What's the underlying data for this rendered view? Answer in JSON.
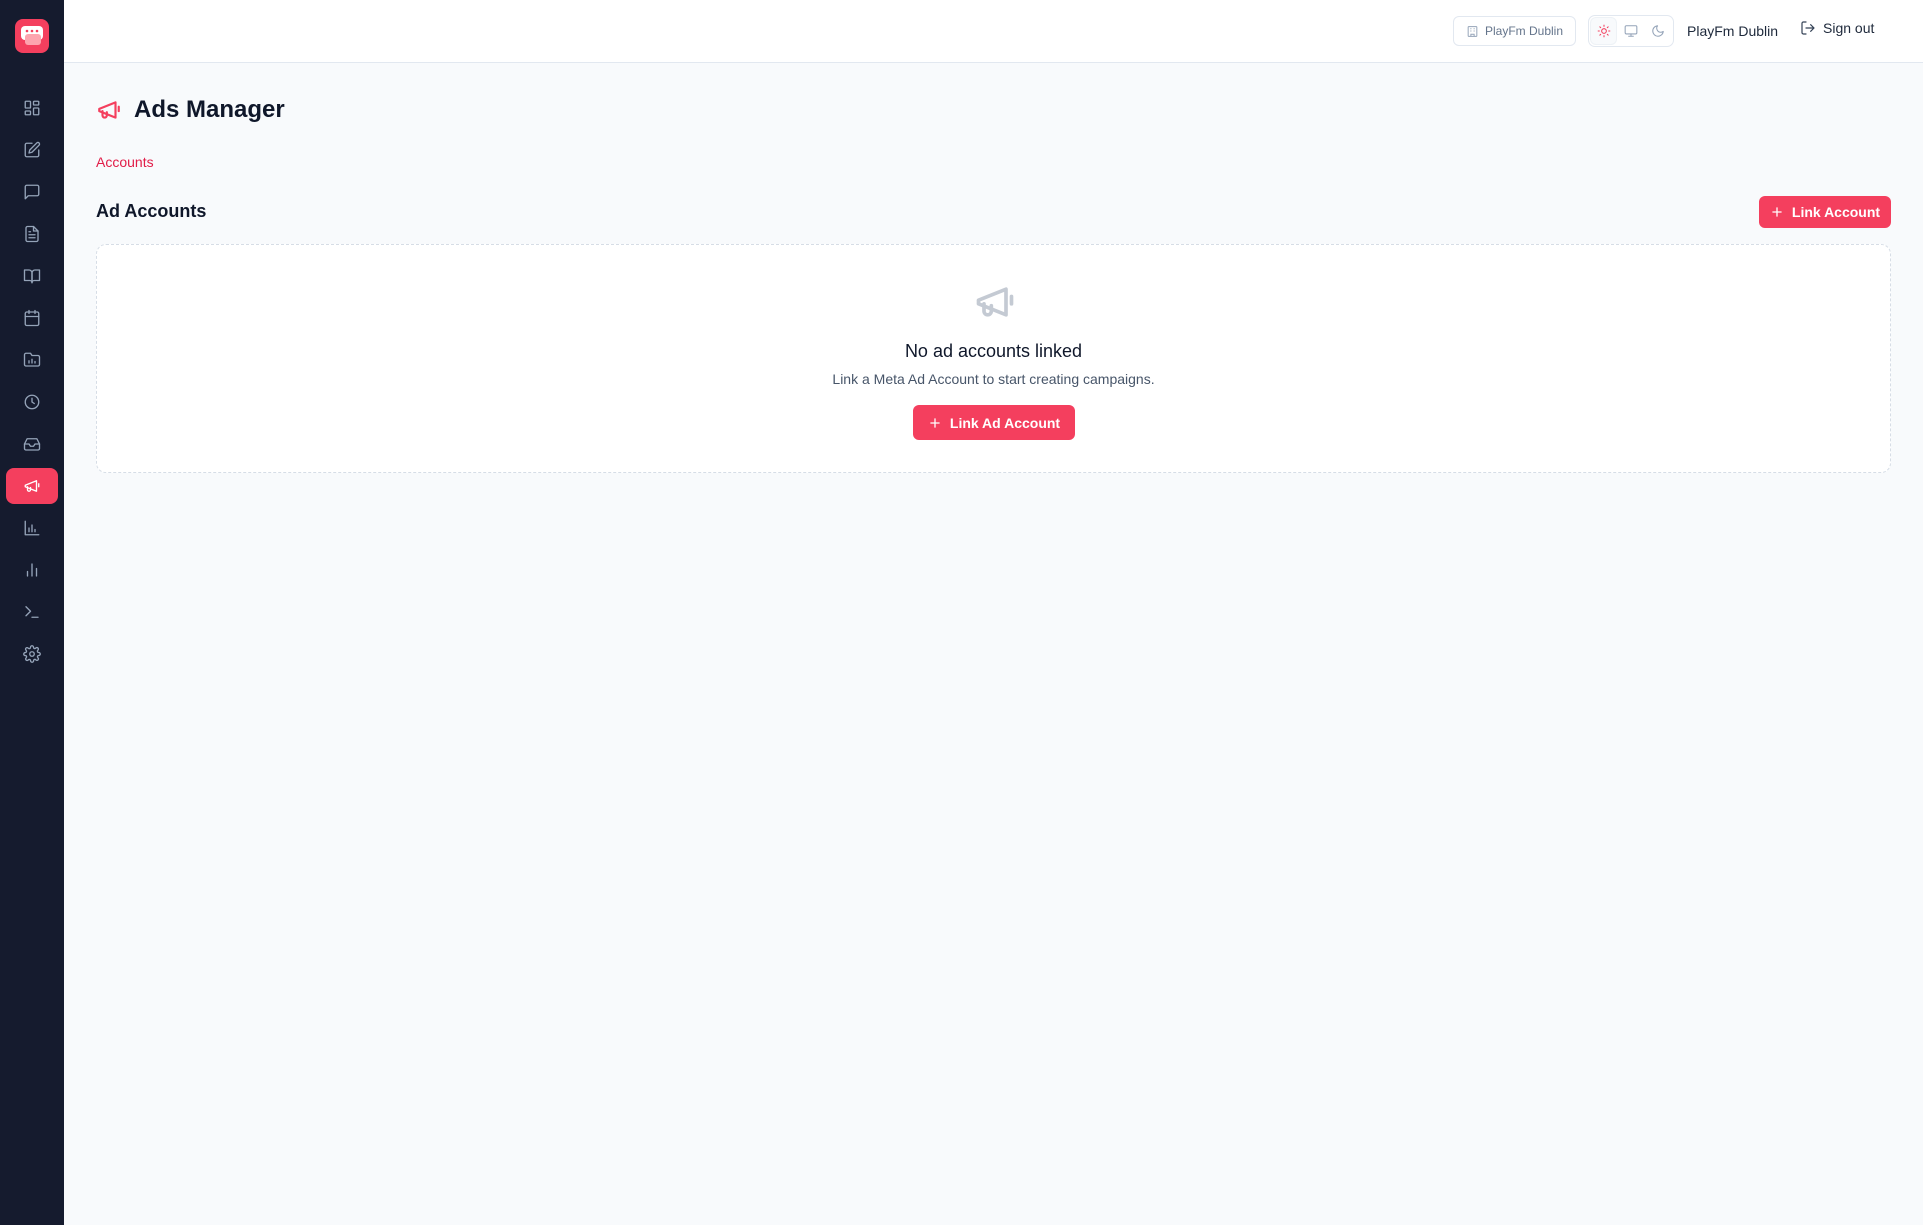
{
  "sidebar": {
    "logo_icon": "chat-app-logo",
    "items": [
      {
        "icon": "dashboard-grid-icon",
        "active": false
      },
      {
        "icon": "edit-icon",
        "active": false
      },
      {
        "icon": "message-icon",
        "active": false
      },
      {
        "icon": "document-icon",
        "active": false
      },
      {
        "icon": "book-icon",
        "active": false
      },
      {
        "icon": "calendar-icon",
        "active": false
      },
      {
        "icon": "folder-chart-icon",
        "active": false
      },
      {
        "icon": "clock-icon",
        "active": false
      },
      {
        "icon": "inbox-icon",
        "active": false
      },
      {
        "icon": "megaphone-icon",
        "active": true
      },
      {
        "icon": "bar-chart-icon",
        "active": false
      },
      {
        "icon": "analytics-icon",
        "active": false
      },
      {
        "icon": "terminal-icon",
        "active": false
      },
      {
        "icon": "settings-icon",
        "active": false
      }
    ]
  },
  "topbar": {
    "org_chip": "PlayFm Dublin",
    "theme_options": [
      "sun-icon",
      "monitor-icon",
      "moon-icon"
    ],
    "theme_active": "sun-icon",
    "user_name": "PlayFm Dublin",
    "sign_out": "Sign out"
  },
  "page": {
    "title": "Ads Manager",
    "breadcrumb": "Accounts",
    "section_title": "Ad Accounts",
    "link_account_button": "Link Account"
  },
  "empty_state": {
    "title": "No ad accounts linked",
    "subtitle": "Link a Meta Ad Account to start creating campaigns.",
    "button": "Link Ad Account"
  },
  "colors": {
    "accent": "#f43f5e",
    "sidebar_bg": "#151b2e",
    "page_bg": "#f8fafc"
  }
}
